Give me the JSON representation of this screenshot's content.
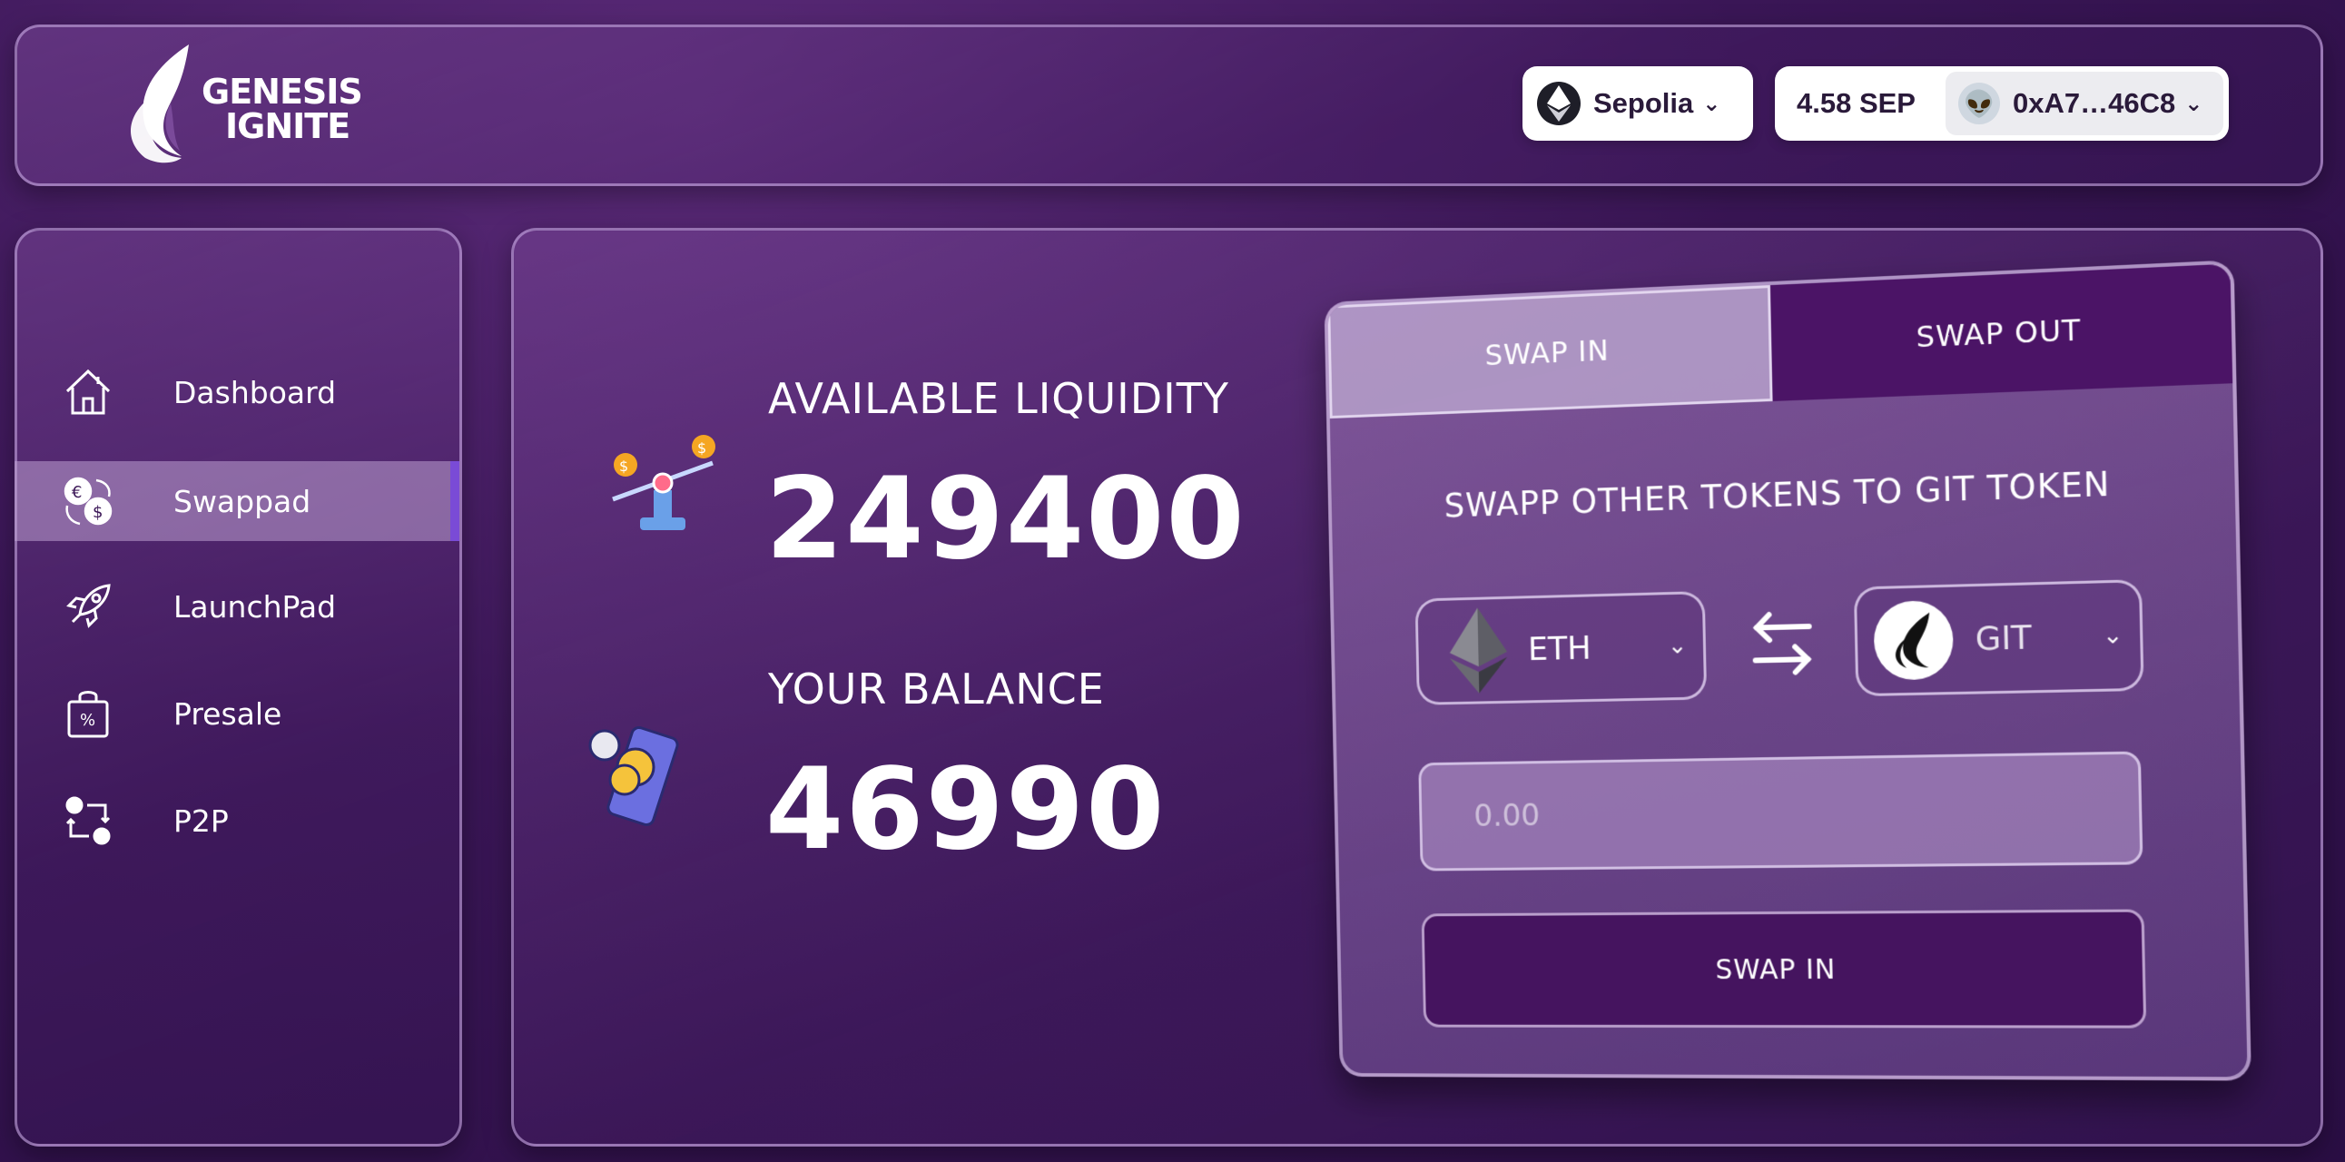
{
  "brand": {
    "logo_text": "GENESIS IGNITE",
    "line1": "GENESIS",
    "line2": "IGNITE"
  },
  "header": {
    "network": {
      "label": "Sepolia",
      "icon": "ethereum-icon"
    },
    "account": {
      "balance": "4.58 SEP",
      "address": "0xA7…46C8",
      "avatar_icon": "alien-icon"
    }
  },
  "sidebar": {
    "items": [
      {
        "label": "Dashboard",
        "icon": "home-icon",
        "active": false
      },
      {
        "label": "Swappad",
        "icon": "currency-exchange-icon",
        "active": true
      },
      {
        "label": "LaunchPad",
        "icon": "rocket-icon",
        "active": false
      },
      {
        "label": "Presale",
        "icon": "shopping-bag-percent-icon",
        "active": false
      },
      {
        "label": "P2P",
        "icon": "p2p-transfer-icon",
        "active": false
      }
    ]
  },
  "stats": {
    "liquidity": {
      "title": "AVAILABLE LIQUIDITY",
      "value": "249400"
    },
    "balance": {
      "title": "YOUR BALANCE",
      "value": "46990"
    }
  },
  "swap": {
    "tabs": [
      {
        "label": "SWAP IN",
        "active": true
      },
      {
        "label": "SWAP OUT",
        "active": false
      }
    ],
    "heading": "SWAPP OTHER TOKENS TO GIT TOKEN",
    "from_token": "ETH",
    "to_token": "GIT",
    "amount_placeholder": "0.00",
    "button_label": "SWAP IN"
  },
  "colors": {
    "accent_purple": "#45145f",
    "active_indicator": "#7a4bd6",
    "background": "#3a1656"
  }
}
